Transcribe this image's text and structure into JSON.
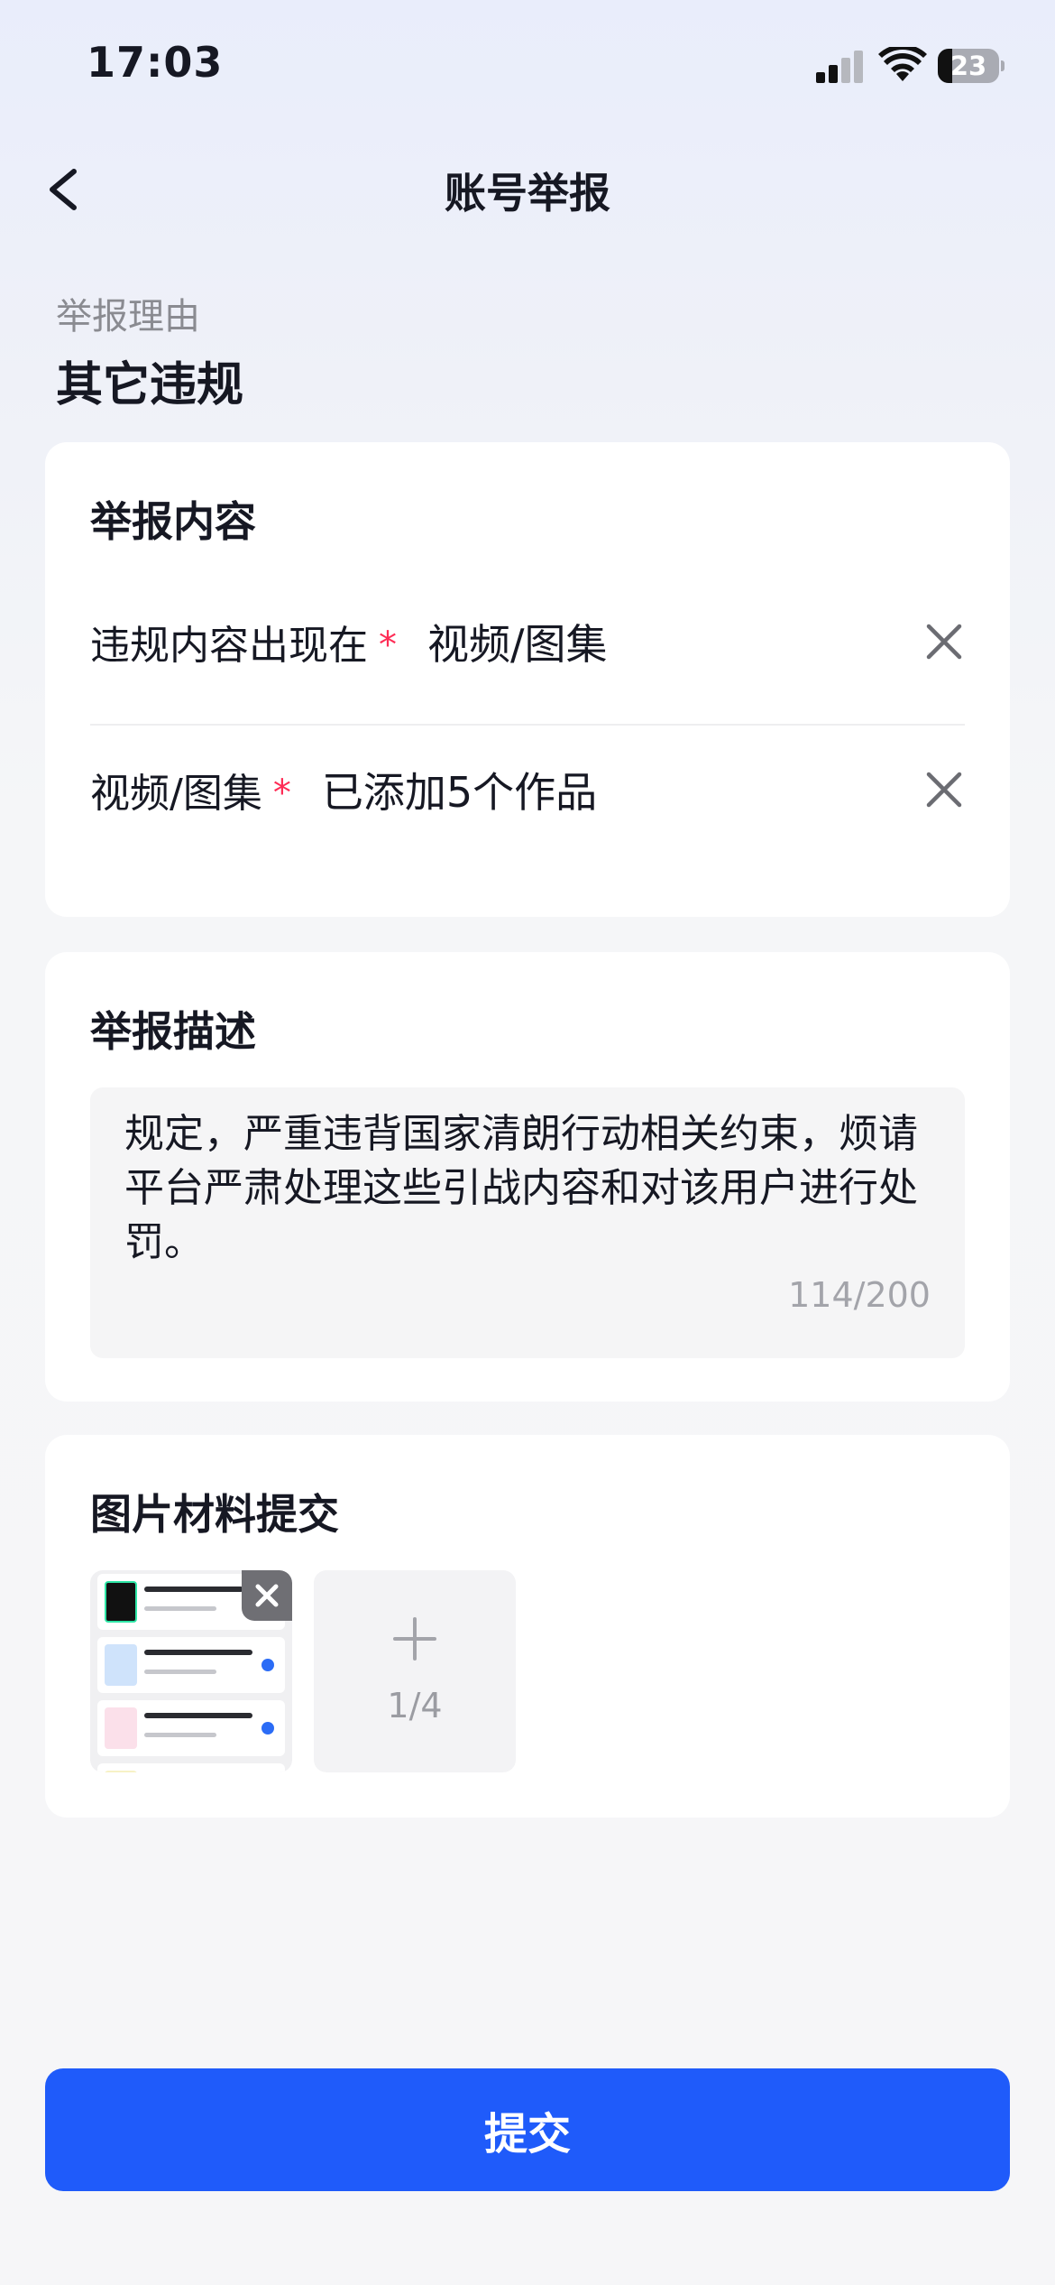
{
  "status_bar": {
    "time": "17:03",
    "battery_level": "23",
    "battery_fraction": 0.23
  },
  "nav": {
    "title": "账号举报",
    "back_icon": "chevron-left-icon"
  },
  "reason": {
    "label": "举报理由",
    "value": "其它违规"
  },
  "content_card": {
    "title": "举报内容",
    "rows": [
      {
        "label": "违规内容出现在",
        "required_mark": "*",
        "value": "视频/图集",
        "clear_icon": "close-icon"
      },
      {
        "label": "视频/图集",
        "required_mark": "*",
        "value": "已添加5个作品",
        "clear_icon": "close-icon"
      }
    ]
  },
  "description_card": {
    "title": "举报描述",
    "text": "规定，严重违背国家清朗行动相关约束，烦请平台严肃处理这些引战内容和对该用户进行处罚。",
    "counter": "114/200"
  },
  "images_card": {
    "title": "图片材料提交",
    "remove_icon": "close-icon",
    "add_icon": "plus-icon",
    "count_label": "1/4"
  },
  "submit": {
    "label": "提交"
  },
  "colors": {
    "accent": "#1f5bfa",
    "required": "#fe2c55",
    "text_primary": "#161823",
    "text_secondary": "#8a8b91"
  }
}
